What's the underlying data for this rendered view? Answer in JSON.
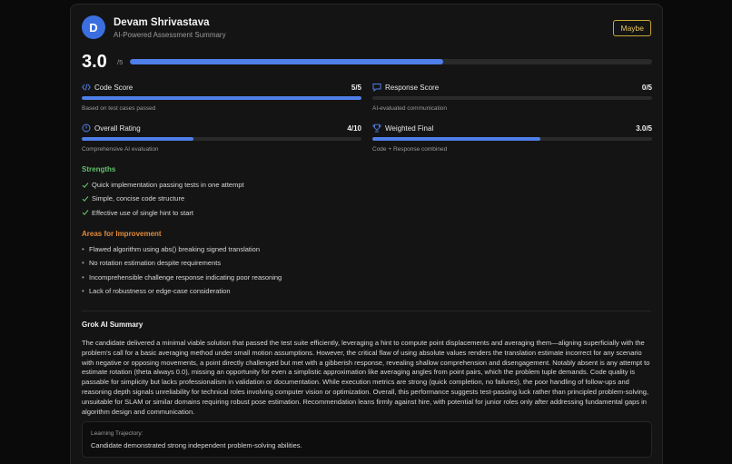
{
  "candidate": {
    "initial": "D",
    "name": "Devam Shrivastava",
    "subtitle": "AI-Powered Assessment Summary",
    "decision": "Maybe"
  },
  "overall": {
    "score": "3.0",
    "max": "/5",
    "fraction": 0.6
  },
  "metrics": [
    {
      "icon": "code-icon",
      "label": "Code Score",
      "value": "5/5",
      "fraction": 1.0,
      "desc": "Based on test cases passed"
    },
    {
      "icon": "message-icon",
      "label": "Response Score",
      "value": "0/5",
      "fraction": 0.0,
      "desc": "AI-evaluated communication"
    },
    {
      "icon": "rating-icon",
      "label": "Overall Rating",
      "value": "4/10",
      "fraction": 0.4,
      "desc": "Comprehensive AI evaluation"
    },
    {
      "icon": "trophy-icon",
      "label": "Weighted Final",
      "value": "3.0/5",
      "fraction": 0.6,
      "desc": "Code + Response combined"
    }
  ],
  "strengths": {
    "title": "Strengths",
    "items": [
      "Quick implementation passing tests in one attempt",
      "Simple, concise code structure",
      "Effective use of single hint to start"
    ]
  },
  "improvements": {
    "title": "Areas for Improvement",
    "items": [
      "Flawed algorithm using abs() breaking signed translation",
      "No rotation estimation despite requirements",
      "Incomprehensible challenge response indicating poor reasoning",
      "Lack of robustness or edge-case consideration"
    ]
  },
  "summary": {
    "title": "Grok AI Summary",
    "text": "The candidate delivered a minimal viable solution that passed the test suite efficiently, leveraging a hint to compute point displacements and averaging them—aligning superficially with the problem's call for a basic averaging method under small motion assumptions. However, the critical flaw of using absolute values renders the translation estimate incorrect for any scenario with negative or opposing movements, a point directly challenged but met with a gibberish response, revealing shallow comprehension and disengagement. Notably absent is any attempt to estimate rotation (theta always 0.0), missing an opportunity for even a simplistic approximation like averaging angles from point pairs, which the problem tuple demands. Code quality is passable for simplicity but lacks professionalism in validation or documentation. While execution metrics are strong (quick completion, no failures), the poor handling of follow-ups and reasoning depth signals unreliability for technical roles involving computer vision or optimization. Overall, this performance suggests test-passing luck rather than principled problem-solving, unsuitable for SLAM or similar domains requiring robust pose estimation. Recommendation leans firmly against hire, with potential for junior roles only after addressing fundamental gaps in algorithm design and communication."
  },
  "trajectory": {
    "label": "Learning Trajectory:",
    "text": "Candidate demonstrated strong independent problem-solving abilities."
  },
  "colors": {
    "accent": "#4f7fe8",
    "strength": "#5fc06a",
    "improvement": "#e38a3a",
    "badge": "#e3c35b"
  }
}
